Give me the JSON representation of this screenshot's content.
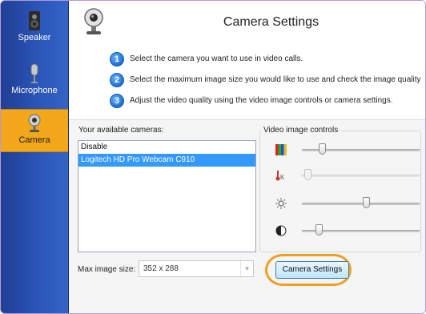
{
  "sidebar": {
    "items": [
      {
        "label": "Speaker",
        "icon": "speaker-icon",
        "active": false
      },
      {
        "label": "Microphone",
        "icon": "microphone-icon",
        "active": false
      },
      {
        "label": "Camera",
        "icon": "camera-icon",
        "active": true
      }
    ]
  },
  "header": {
    "title": "Camera Settings",
    "icon": "webcam-icon"
  },
  "steps": [
    {
      "num": "1",
      "text": "Select the camera you want to use in video calls."
    },
    {
      "num": "2",
      "text": "Select the maximum image size you would like to use and check the image quality"
    },
    {
      "num": "3",
      "text": "Adjust the video quality using the video image controls or camera settings."
    }
  ],
  "cameras": {
    "label": "Your available cameras:",
    "items": [
      "Disable",
      "Logitech HD Pro Webcam C910"
    ],
    "selected": "Logitech HD Pro Webcam C910"
  },
  "video_controls": {
    "title": "Video image controls",
    "sliders": [
      {
        "name": "color",
        "icon": "color-bars-icon",
        "value": 0.15,
        "enabled": true
      },
      {
        "name": "white-balance",
        "icon": "temperature-k-icon",
        "value": 0.02,
        "enabled": false
      },
      {
        "name": "brightness",
        "icon": "sun-icon",
        "value": 0.55,
        "enabled": true
      },
      {
        "name": "contrast",
        "icon": "contrast-icon",
        "value": 0.12,
        "enabled": true
      }
    ]
  },
  "max_image": {
    "label": "Max image size:",
    "value": "352 x 288"
  },
  "camera_settings_button": {
    "label": "Camera Settings",
    "highlight_color": "#f0a020"
  },
  "colors": {
    "sidebar": "#2a55b8",
    "active": "#f3a81c",
    "selection": "#3399ff"
  }
}
